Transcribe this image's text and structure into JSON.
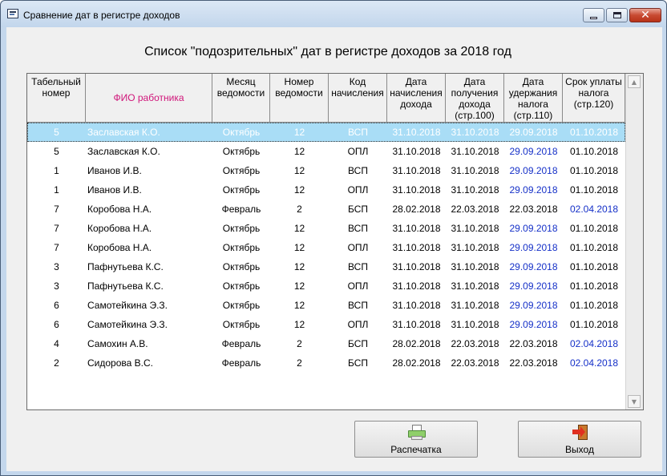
{
  "window": {
    "title": "Сравнение дат в регистре доходов",
    "close_glyph": "✕"
  },
  "report": {
    "title": "Список \"подозрительных\" дат в регистре доходов за 2018 год"
  },
  "table": {
    "columns": [
      {
        "key": "tab",
        "label": "Табельный номер",
        "width": 73
      },
      {
        "key": "fio",
        "label": "ФИО работника",
        "width": 158
      },
      {
        "key": "month",
        "label": "Месяц ведомости",
        "width": 72
      },
      {
        "key": "num",
        "label": "Номер ведомости",
        "width": 73
      },
      {
        "key": "code",
        "label": "Код начисления",
        "width": 73
      },
      {
        "key": "d1",
        "label": "Дата начисления дохода",
        "width": 73
      },
      {
        "key": "d2",
        "label": "Дата получения дохода (стр.100)",
        "width": 73
      },
      {
        "key": "d3",
        "label": "Дата удержания налога (стр.110)",
        "width": 73
      },
      {
        "key": "d4",
        "label": "Срок уплаты налога (стр.120)",
        "width": 78
      }
    ],
    "rows": [
      {
        "tab": "5",
        "fio": "Заславская К.О.",
        "month": "Октябрь",
        "num": "12",
        "code": "ВСП",
        "d1": "31.10.2018",
        "d2": "31.10.2018",
        "d3": "29.09.2018",
        "d4": "01.10.2018",
        "blue": "d3",
        "selected": true
      },
      {
        "tab": "5",
        "fio": "Заславская К.О.",
        "month": "Октябрь",
        "num": "12",
        "code": "ОПЛ",
        "d1": "31.10.2018",
        "d2": "31.10.2018",
        "d3": "29.09.2018",
        "d4": "01.10.2018",
        "blue": "d3"
      },
      {
        "tab": "1",
        "fio": "Иванов И.В.",
        "month": "Октябрь",
        "num": "12",
        "code": "ВСП",
        "d1": "31.10.2018",
        "d2": "31.10.2018",
        "d3": "29.09.2018",
        "d4": "01.10.2018",
        "blue": "d3"
      },
      {
        "tab": "1",
        "fio": "Иванов И.В.",
        "month": "Октябрь",
        "num": "12",
        "code": "ОПЛ",
        "d1": "31.10.2018",
        "d2": "31.10.2018",
        "d3": "29.09.2018",
        "d4": "01.10.2018",
        "blue": "d3"
      },
      {
        "tab": "7",
        "fio": "Коробова Н.А.",
        "month": "Февраль",
        "num": "2",
        "code": "БСП",
        "d1": "28.02.2018",
        "d2": "22.03.2018",
        "d3": "22.03.2018",
        "d4": "02.04.2018",
        "blue": "d4"
      },
      {
        "tab": "7",
        "fio": "Коробова Н.А.",
        "month": "Октябрь",
        "num": "12",
        "code": "ВСП",
        "d1": "31.10.2018",
        "d2": "31.10.2018",
        "d3": "29.09.2018",
        "d4": "01.10.2018",
        "blue": "d3"
      },
      {
        "tab": "7",
        "fio": "Коробова Н.А.",
        "month": "Октябрь",
        "num": "12",
        "code": "ОПЛ",
        "d1": "31.10.2018",
        "d2": "31.10.2018",
        "d3": "29.09.2018",
        "d4": "01.10.2018",
        "blue": "d3"
      },
      {
        "tab": "3",
        "fio": "Пафнутьева К.С.",
        "month": "Октябрь",
        "num": "12",
        "code": "ВСП",
        "d1": "31.10.2018",
        "d2": "31.10.2018",
        "d3": "29.09.2018",
        "d4": "01.10.2018",
        "blue": "d3"
      },
      {
        "tab": "3",
        "fio": "Пафнутьева К.С.",
        "month": "Октябрь",
        "num": "12",
        "code": "ОПЛ",
        "d1": "31.10.2018",
        "d2": "31.10.2018",
        "d3": "29.09.2018",
        "d4": "01.10.2018",
        "blue": "d3"
      },
      {
        "tab": "6",
        "fio": "Самотейкина Э.З.",
        "month": "Октябрь",
        "num": "12",
        "code": "ВСП",
        "d1": "31.10.2018",
        "d2": "31.10.2018",
        "d3": "29.09.2018",
        "d4": "01.10.2018",
        "blue": "d3"
      },
      {
        "tab": "6",
        "fio": "Самотейкина Э.З.",
        "month": "Октябрь",
        "num": "12",
        "code": "ОПЛ",
        "d1": "31.10.2018",
        "d2": "31.10.2018",
        "d3": "29.09.2018",
        "d4": "01.10.2018",
        "blue": "d3"
      },
      {
        "tab": "4",
        "fio": "Самохин А.В.",
        "month": "Февраль",
        "num": "2",
        "code": "БСП",
        "d1": "28.02.2018",
        "d2": "22.03.2018",
        "d3": "22.03.2018",
        "d4": "02.04.2018",
        "blue": "d4"
      },
      {
        "tab": "2",
        "fio": "Сидорова В.С.",
        "month": "Февраль",
        "num": "2",
        "code": "БСП",
        "d1": "28.02.2018",
        "d2": "22.03.2018",
        "d3": "22.03.2018",
        "d4": "02.04.2018",
        "blue": "d4"
      }
    ]
  },
  "scrollbar": {
    "up_glyph": "▲",
    "down_glyph": "▼"
  },
  "buttons": {
    "print_label": "Распечатка",
    "exit_label": "Выход"
  },
  "colors": {
    "selected_row": "#a9ddf6",
    "highlight_date": "#1530c8",
    "fio_header": "#d0157a"
  }
}
